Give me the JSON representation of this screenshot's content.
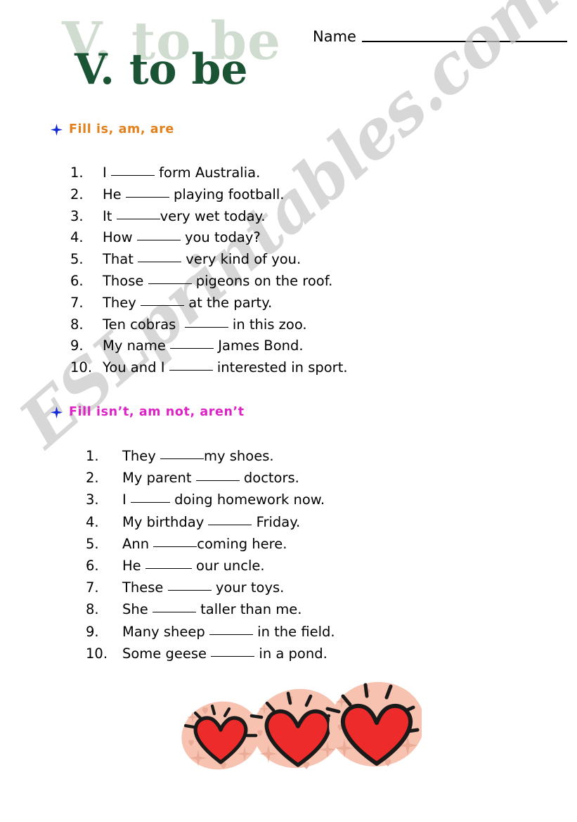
{
  "title": {
    "main": "V. to be",
    "ghost": "V. to be",
    "color": "#1a5434",
    "ghost_color": "#cfdccf"
  },
  "name_field": {
    "label": "Name",
    "value": ""
  },
  "watermark": {
    "text": "ESLprintables.com",
    "color": "#c9c9c9"
  },
  "sections": [
    {
      "heading": "Fill is, am, are",
      "heading_color": "#e2801c",
      "bullet_icon": "star-icon",
      "items": [
        {
          "number": "1.",
          "before": "I ",
          "blank_width": 62,
          "after": " form Australia."
        },
        {
          "number": "2.",
          "before": "He ",
          "blank_width": 62,
          "after": " playing football."
        },
        {
          "number": "3.",
          "before": "It ",
          "blank_width": 62,
          "after": "very wet today."
        },
        {
          "number": "4.",
          "before": "How ",
          "blank_width": 62,
          "after": " you today?"
        },
        {
          "number": "5.",
          "before": "That ",
          "blank_width": 62,
          "after": " very kind of you."
        },
        {
          "number": "6.",
          "before": "Those ",
          "blank_width": 62,
          "after": " pigeons on the roof."
        },
        {
          "number": "7.",
          "before": "They ",
          "blank_width": 62,
          "after": " at the party."
        },
        {
          "number": "8.",
          "before": "Ten cobras  ",
          "blank_width": 62,
          "after": " in this zoo."
        },
        {
          "number": "9.",
          "before": "My name ",
          "blank_width": 62,
          "after": " James Bond."
        },
        {
          "number": "10.",
          "before": "You and I ",
          "blank_width": 62,
          "after": " interested in sport."
        }
      ]
    },
    {
      "heading": "Fill isn’t, am not, aren’t",
      "heading_color": "#dd22c6",
      "bullet_icon": "star-icon",
      "items": [
        {
          "number": "1.",
          "before": "They ",
          "blank_width": 62,
          "after": "my shoes."
        },
        {
          "number": "2.",
          "before": "My parent ",
          "blank_width": 62,
          "after": " doctors."
        },
        {
          "number": "3.",
          "before": "I ",
          "blank_width": 56,
          "after": " doing homework now."
        },
        {
          "number": "4.",
          "before": "My birthday ",
          "blank_width": 62,
          "after": " Friday."
        },
        {
          "number": "5.",
          "before": "Ann ",
          "blank_width": 62,
          "after": "coming here."
        },
        {
          "number": "6.",
          "before": "He ",
          "blank_width": 66,
          "after": " our uncle."
        },
        {
          "number": "7.",
          "before": "These ",
          "blank_width": 62,
          "after": " your toys."
        },
        {
          "number": "8.",
          "before": "She ",
          "blank_width": 62,
          "after": " taller than me."
        },
        {
          "number": "9.",
          "before": "Many sheep ",
          "blank_width": 62,
          "after": " in the field."
        },
        {
          "number": "10.",
          "before": "Some geese ",
          "blank_width": 62,
          "after": " in a pond."
        }
      ]
    }
  ],
  "decoration": {
    "name": "three-hearts",
    "heart_color": "#ee2b2b",
    "outline_color": "#1a1a1a",
    "blob_color": "#f7c2b0",
    "sparkle_color": "#e8a893",
    "count": 3
  }
}
